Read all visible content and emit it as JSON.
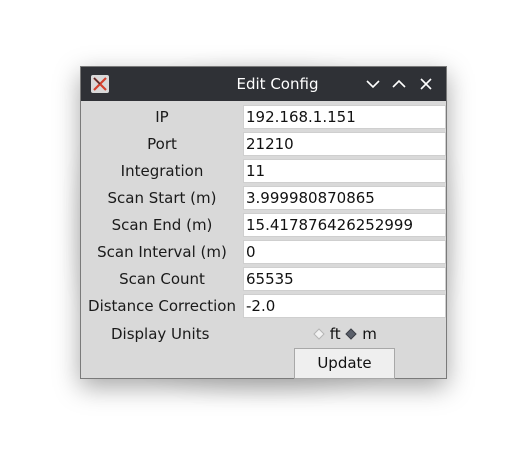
{
  "window": {
    "title": "Edit Config",
    "icons": [
      "app-icon",
      "chevron-down-icon",
      "chevron-up-icon",
      "close-icon"
    ]
  },
  "form": {
    "fields": [
      {
        "label": "IP",
        "value": "192.168.1.151"
      },
      {
        "label": "Port",
        "value": "21210"
      },
      {
        "label": "Integration",
        "value": "11"
      },
      {
        "label": "Scan Start (m)",
        "value": "3.999980870865"
      },
      {
        "label": "Scan End (m)",
        "value": "15.417876426252999"
      },
      {
        "label": "Scan Interval (m)",
        "value": "0"
      },
      {
        "label": "Scan Count",
        "value": "65535"
      },
      {
        "label": "Distance Correction",
        "value": "-2.0"
      }
    ],
    "display_units": {
      "label": "Display Units",
      "options": [
        "ft",
        "m"
      ],
      "selected": "m"
    },
    "update_label": "Update"
  },
  "colors": {
    "titlebar": "#2f3136",
    "window_bg": "#d9d9d9",
    "field_bg": "#ffffff",
    "accent": "#d4412e"
  }
}
